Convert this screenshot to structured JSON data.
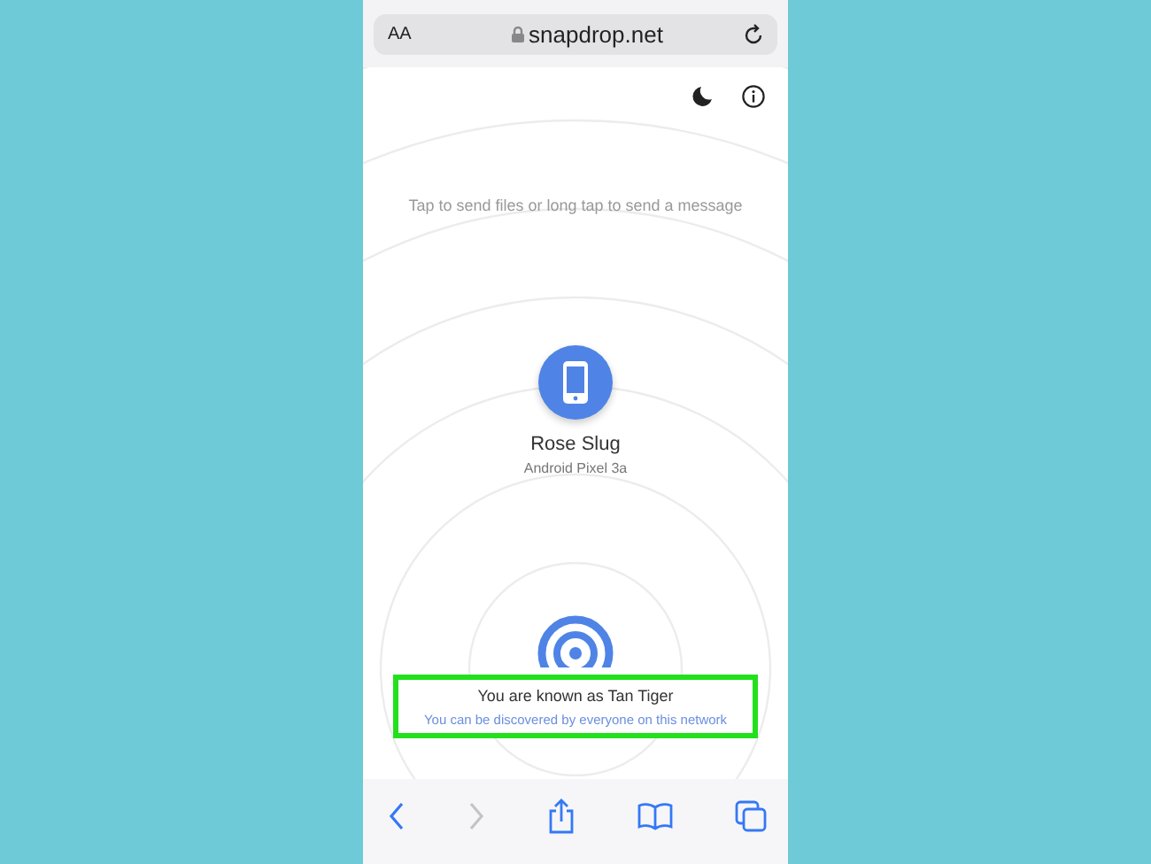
{
  "address_bar": {
    "text_size_label": "AA",
    "url": "snapdrop.net"
  },
  "hint": "Tap to send files or long tap to send a message",
  "peers": [
    {
      "name": "Rose Slug",
      "device": "Android Pixel 3a"
    }
  ],
  "footer": {
    "title": "You are known as Tan Tiger",
    "subtitle": "You can be discovered by everyone on this network",
    "highlighted": true
  },
  "toolbar": [
    {
      "kind": "back",
      "disabled": false
    },
    {
      "kind": "forward",
      "disabled": true
    },
    {
      "kind": "share",
      "disabled": false
    },
    {
      "kind": "bookmarks",
      "disabled": false
    },
    {
      "kind": "tabs",
      "disabled": false
    }
  ]
}
